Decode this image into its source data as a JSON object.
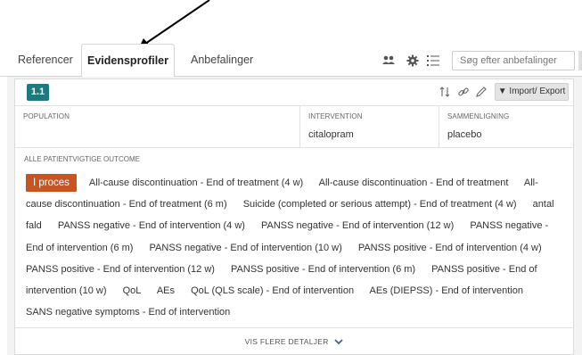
{
  "tabs": [
    {
      "label": "Referencer"
    },
    {
      "label": "Evidensprofiler",
      "active": true
    },
    {
      "label": "Anbefalinger"
    }
  ],
  "toolbar": {
    "icons": [
      "users-icon",
      "gear-icon",
      "list-icon"
    ],
    "search_placeholder": "Søg efter anbefalinger"
  },
  "question": {
    "number": "1.1",
    "header_icons": [
      "sort-icon",
      "link-icon",
      "edit-icon"
    ],
    "import_export_label": "▼ Import/ Export"
  },
  "pico": {
    "population": {
      "label": "POPULATION",
      "value": ""
    },
    "intervention": {
      "label": "INTERVENTION",
      "value": "citalopram"
    },
    "comparison": {
      "label": "SAMMENLIGNING",
      "value": "placebo"
    }
  },
  "outcomes": {
    "label": "ALLE PATIENTVIGTIGE OUTCOME",
    "status_badge": "I proces",
    "items": [
      "All-cause discontinuation - End of treatment (4 w)",
      "All-cause discontinuation - End of treatment",
      "All-cause discontinuation - End of treatment (6 m)",
      "Suicide (completed or serious attempt) - End of treatment (4 w)",
      "antal fald",
      "PANSS negative - End of intervention (4 w)",
      "PANSS negative - End of intervention (12 w)",
      "PANSS negative - End of intervention (6 m)",
      "PANSS negative - End of intervention (10 w)",
      "PANSS positive - End of intervention (4 w)",
      "PANSS positive - End of intervention (12 w)",
      "PANSS positive - End of intervention (6 m)",
      "PANSS positive - End of intervention (10 w)",
      "QoL",
      "AEs",
      "QoL (QLS scale) - End of intervention",
      "AEs (DIEPSS) - End of intervention",
      "SANS negative symptoms - End of intervention"
    ]
  },
  "footer": {
    "show_more_label": "VIS FLERE DETALJER"
  },
  "colors": {
    "badge_teal": "#1f7a80",
    "status_orange": "#c9541f",
    "panel_gray": "#f3f3f3"
  }
}
